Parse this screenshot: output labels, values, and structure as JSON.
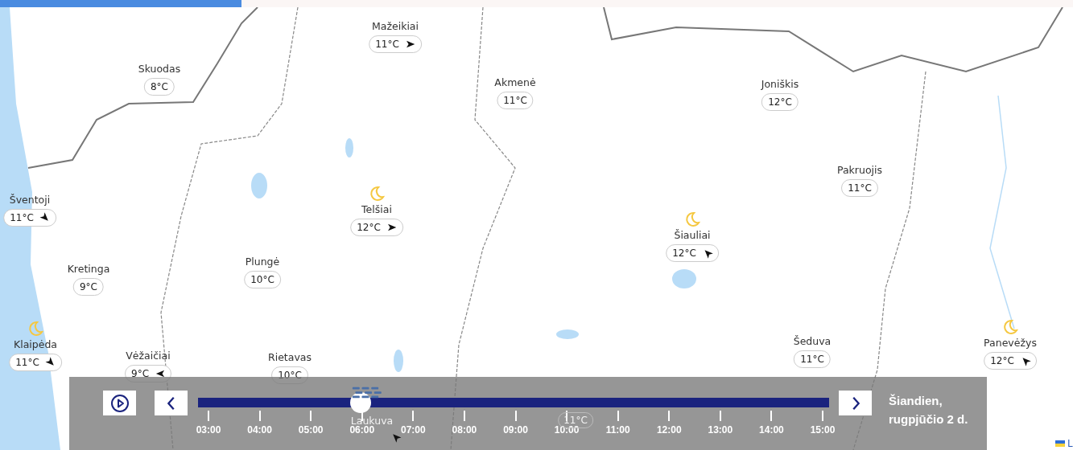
{
  "loading_bar": {
    "level": 0.225
  },
  "cities": [
    {
      "name": "Mažeikiai",
      "temp": "11°C",
      "wind": {
        "kind": "east"
      }
    },
    {
      "name": "Skuodas",
      "temp": "8°C"
    },
    {
      "name": "Akmenė",
      "temp": "11°C"
    },
    {
      "name": "Joniškis",
      "temp": "12°C"
    },
    {
      "name": "Pakruojis",
      "temp": "11°C"
    },
    {
      "name": "Šventoji",
      "temp": "11°C",
      "wind": {
        "kind": "southeast"
      }
    },
    {
      "name": "Telšiai",
      "temp": "12°C",
      "wind": {
        "kind": "east"
      },
      "weather": {
        "kind": "moon"
      }
    },
    {
      "name": "Šiauliai",
      "temp": "12°C",
      "wind": {
        "kind": "northwest"
      },
      "weather": {
        "kind": "moon"
      }
    },
    {
      "name": "Plungė",
      "temp": "10°C"
    },
    {
      "name": "Kretinga",
      "temp": "9°C"
    },
    {
      "name": "Klaipėda",
      "temp": "11°C",
      "wind": {
        "kind": "southeast"
      },
      "weather": {
        "kind": "moon"
      }
    },
    {
      "name": "Šeduva",
      "temp": "11°C"
    },
    {
      "name": "Panevėžys",
      "temp": "12°C",
      "wind": {
        "kind": "northwest"
      },
      "weather": {
        "kind": "moon"
      }
    },
    {
      "name": "Vėžaičiai",
      "temp": "9°C",
      "wind": {
        "kind": "west"
      }
    },
    {
      "name": "Rietavas",
      "temp": "10°C"
    },
    {
      "name": "Laukuva",
      "wind": {
        "kind": "northwest"
      },
      "weather": {
        "kind": "rain"
      }
    },
    {
      "temp": "11°C"
    }
  ],
  "timeline": {
    "level": 0.258,
    "ticks": [
      "03:00",
      "04:00",
      "05:00",
      "06:00",
      "07:00",
      "08:00",
      "09:00",
      "10:00",
      "11:00",
      "12:00",
      "13:00",
      "14:00",
      "15:00"
    ],
    "date_line_1": "Šiandien,",
    "date_line_2": "rugpjūčio 2 d."
  },
  "attribution": {
    "text": "L"
  }
}
